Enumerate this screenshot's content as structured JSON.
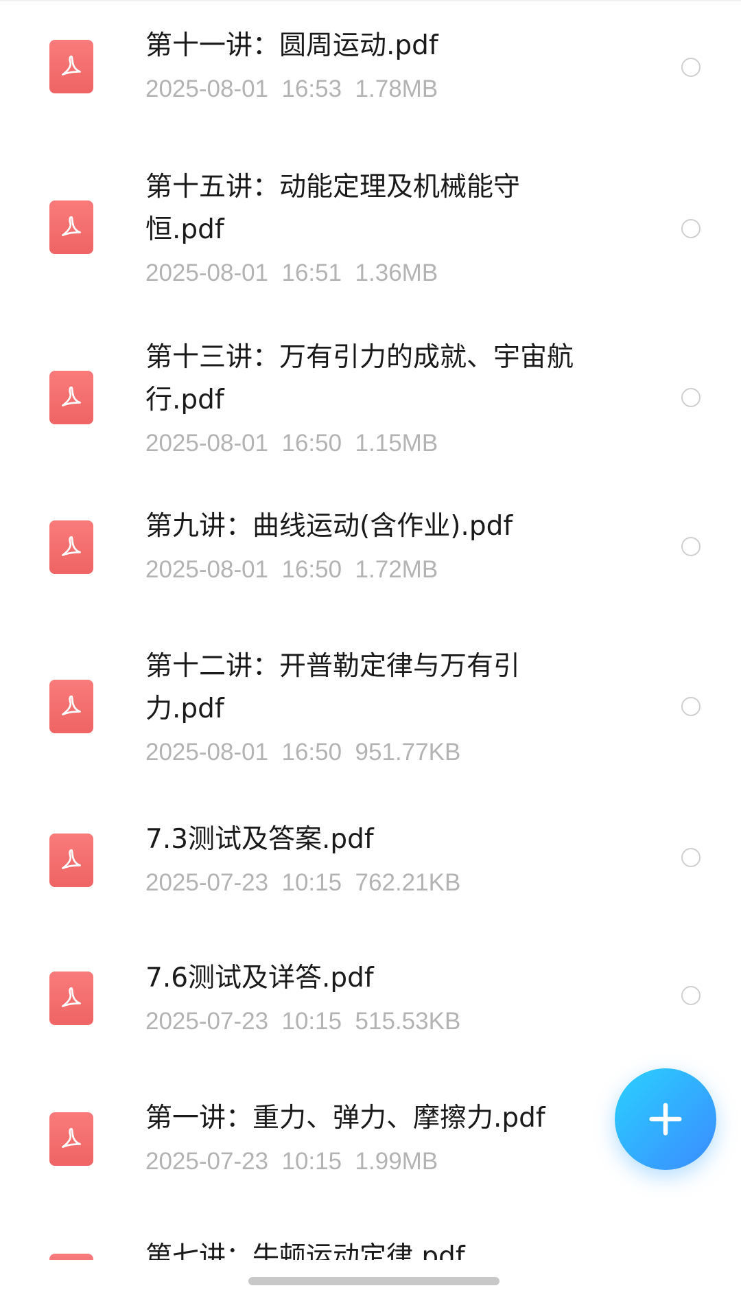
{
  "files": [
    {
      "name": "第十一讲：圆周运动.pdf",
      "date": "2025-08-01",
      "time": "16:53",
      "size": "1.78MB"
    },
    {
      "name": "第十五讲：动能定理及机械能守\n恒.pdf",
      "date": "2025-08-01",
      "time": "16:51",
      "size": "1.36MB"
    },
    {
      "name": "第十三讲：万有引力的成就、宇宙航\n行.pdf",
      "date": "2025-08-01",
      "time": "16:50",
      "size": "1.15MB"
    },
    {
      "name": "第九讲：曲线运动(含作业).pdf",
      "date": "2025-08-01",
      "time": "16:50",
      "size": "1.72MB"
    },
    {
      "name": "第十二讲：开普勒定律与万有引\n力.pdf",
      "date": "2025-08-01",
      "time": "16:50",
      "size": "951.77KB"
    },
    {
      "name": "7.3测试及答案.pdf",
      "date": "2025-07-23",
      "time": "10:15",
      "size": "762.21KB"
    },
    {
      "name": "7.6测试及详答.pdf",
      "date": "2025-07-23",
      "time": "10:15",
      "size": "515.53KB"
    },
    {
      "name": "第一讲：重力、弹力、摩擦力.pdf",
      "date": "2025-07-23",
      "time": "10:15",
      "size": "1.99MB"
    },
    {
      "name": "第七讲：牛顿运动定律.pdf",
      "date": "",
      "time": "",
      "size": ""
    }
  ],
  "icons": {
    "file_icon": "pdf-file-icon",
    "select_icon": "radio-unchecked-icon",
    "fab_icon": "plus-icon"
  },
  "colors": {
    "pdf_icon": "#ef6464",
    "fab_start": "#2ad1ff",
    "fab_end": "#3b8bff",
    "meta_text": "#b3b3b3"
  }
}
